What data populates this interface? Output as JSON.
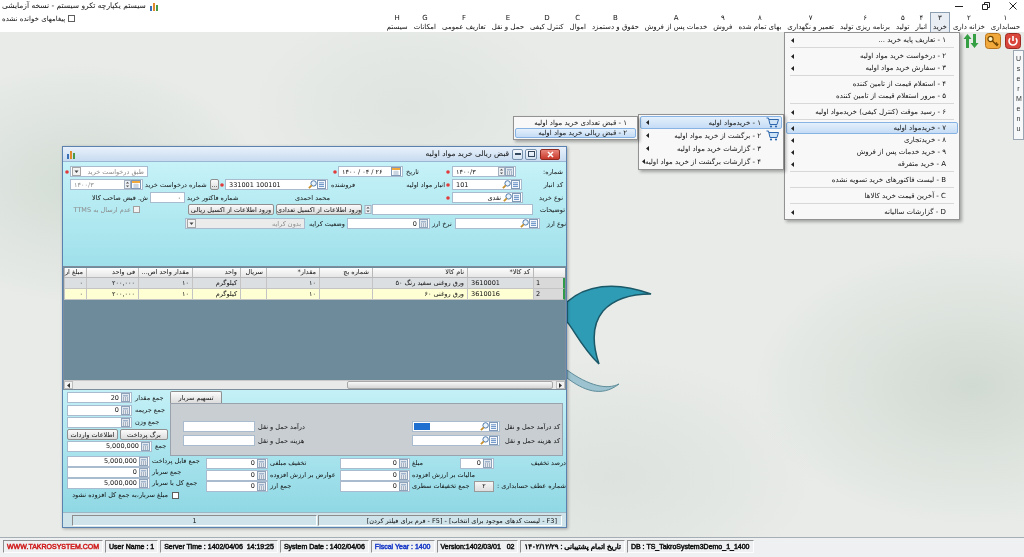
{
  "window": {
    "title": "سیستم یکپارچه تکرو سیستم - نسخه آزمایشی"
  },
  "unread_messages": {
    "label": "پیغامهای خوانده نشده",
    "checked": false
  },
  "menu_bar": [
    {
      "key": "۱",
      "label": "حسابداری",
      "selected": false
    },
    {
      "key": "۲",
      "label": "خزانه داری",
      "selected": false
    },
    {
      "key": "۳",
      "label": "خرید",
      "selected": true
    },
    {
      "key": "۴",
      "label": "انبار",
      "selected": false
    },
    {
      "key": "۵",
      "label": "تولید",
      "selected": false
    },
    {
      "key": "۶",
      "label": "برنامه ریزی تولید",
      "selected": false
    },
    {
      "key": "۷",
      "label": "تعمیر و نگهداری",
      "selected": false
    },
    {
      "key": "۸",
      "label": "بهای تمام شده",
      "selected": false
    },
    {
      "key": "۹",
      "label": "فروش",
      "selected": false
    },
    {
      "key": "A",
      "label": "خدمات پس از فروش",
      "selected": false
    },
    {
      "key": "B",
      "label": "حقوق و دستمزد",
      "selected": false
    },
    {
      "key": "C",
      "label": "اموال",
      "selected": false
    },
    {
      "key": "D",
      "label": "کنترل کیفی",
      "selected": false
    },
    {
      "key": "E",
      "label": "حمل و نقل",
      "selected": false
    },
    {
      "key": "F",
      "label": "تعاریف عمومی",
      "selected": false
    },
    {
      "key": "G",
      "label": "امکانات",
      "selected": false
    },
    {
      "key": "H",
      "label": "سیستم",
      "selected": false
    }
  ],
  "user_menu": {
    "label": "UserMenu"
  },
  "purchase_menu": {
    "groups": [
      [
        {
          "label": "۱ - تعاریف پایه خرید ...",
          "submenu": true,
          "selected": false
        }
      ],
      [
        {
          "label": "۲ - درخواست خرید مواد اولیه",
          "submenu": true,
          "selected": false
        },
        {
          "label": "۳ - سفارش خرید مواد اولیه",
          "submenu": true,
          "selected": false
        }
      ],
      [
        {
          "label": "۴ - استعلام قیمت از تامین کننده",
          "submenu": false,
          "selected": false
        },
        {
          "label": "۵ - مرور استعلام قیمت از تامین کننده",
          "submenu": false,
          "selected": false
        }
      ],
      [
        {
          "label": "۶ - رسید موقت (کنترل کیفی) خریدمواد اولیه",
          "submenu": true,
          "selected": false
        }
      ],
      [
        {
          "label": "۷ - خریدمواد اولیه",
          "submenu": true,
          "selected": true
        },
        {
          "label": "۸ - خریدتجاری",
          "submenu": true,
          "selected": false
        },
        {
          "label": "۹ - خرید خدمات پس از فروش",
          "submenu": true,
          "selected": false
        },
        {
          "label": "A - خرید متفرقه",
          "submenu": true,
          "selected": false
        }
      ],
      [
        {
          "label": "B - لیست فاکتورهای خرید تسویه نشده",
          "submenu": false,
          "selected": false
        }
      ],
      [
        {
          "label": "C - آخرین قیمت خرید کالاها",
          "submenu": false,
          "selected": false
        }
      ],
      [
        {
          "label": "D - گزارشات سالیانه",
          "submenu": true,
          "selected": false
        }
      ]
    ]
  },
  "materials_menu": {
    "items": [
      {
        "label": "۱ - خریدمواد اولیه",
        "kind": "icon",
        "submenu": true,
        "selected": true
      },
      {
        "label": "۲ - برگشت از خرید مواد اولیه",
        "kind": "icon",
        "submenu": true,
        "selected": false
      },
      {
        "label": "۳ - گزارشات خرید مواد اولیه",
        "kind": "plain",
        "submenu": true,
        "selected": false
      },
      {
        "label": "۴ - گزارشات برگشت از خرید مواد اولیه",
        "kind": "plain",
        "submenu": true,
        "selected": false
      }
    ]
  },
  "receipt_menu": {
    "items": [
      {
        "label": "۱ - قبض تعدادی خرید مواد اولیه",
        "selected": false
      },
      {
        "label": "۲ - قبض ریالی خرید مواد اولیه",
        "selected": true
      }
    ]
  },
  "dialog": {
    "title": "قبض ریالی خرید مواد اولیه",
    "form": {
      "number": {
        "label": "شماره:",
        "value": "۱۴۰۰/۳",
        "required": true
      },
      "date": {
        "label": "تاریخ",
        "value": "۱۴۰۰ / ۰۴ / ۲۶",
        "required": true
      },
      "basis": {
        "value": "طبق درخواست خرید",
        "required": true,
        "disabled": true
      },
      "warehouse": {
        "label": "کد انبار",
        "value": "101",
        "required": true,
        "name": "انبار مواد اولیه"
      },
      "vendor": {
        "label": "فروشنده",
        "value": "331001 100101",
        "required": true,
        "name": "محمد احمدی",
        "browse": "..."
      },
      "request_number": {
        "label": "شماره درخواست خرید",
        "value": "۱۴۰۰/۳",
        "disabled": true
      },
      "purchase_type": {
        "label": "نوع خرید",
        "value": "نقدی",
        "required": true
      },
      "invoice_number": {
        "label": "شماره فاکتور خرید",
        "value": "۰"
      },
      "owner_receipt": {
        "label": "ش. قبض صاحب کالا"
      },
      "description": {
        "label": "توضیحات"
      },
      "excel_buttons": [
        "ورود اطلاعات از اکسیل تعدادی",
        "ورود اطلاعات از اکسیل ریالی"
      ],
      "no_ttms": {
        "label": "عدم ارسال به TTMS",
        "checked": false,
        "disabled": true
      },
      "currency": {
        "label": "نوع ارز"
      },
      "exchange_rate": {
        "label": "نرخ ارز",
        "value": "0"
      },
      "freight_status": {
        "label": "وضعیت کرایه",
        "value": "بدون کرایه",
        "disabled": true
      }
    },
    "grid": {
      "columns": [
        "کد کالا*",
        "نام کالا",
        "شماره بچ",
        "مقدار*",
        "سریال",
        "واحد",
        "مقدار واحد اص...",
        "فی واحد",
        "مبلغ ار"
      ],
      "rows": [
        {
          "number": "1",
          "cells": [
            "3610001",
            "ورق روغنی سفید رنگ ۵۰",
            null,
            "۱۰",
            null,
            "کیلوگرم",
            "۱۰",
            "۲۰۰,۰۰۰",
            "۰"
          ],
          "selected": false
        },
        {
          "number": "2",
          "cells": [
            "3610016",
            "ورق روغنی ۶۰",
            null,
            "۱۰",
            null,
            "کیلوگرم",
            "۱۰",
            "۲۰۰,۰۰۰",
            "۰"
          ],
          "selected": true
        }
      ]
    },
    "totals": [
      {
        "label": "جمع مقدار",
        "value": "20"
      },
      {
        "label": "جمع جریمه",
        "value": "0"
      },
      {
        "label": "جمع وزن"
      }
    ],
    "buttons": [
      "برگ پرداخت",
      "اطلاعات واردات"
    ],
    "sum": {
      "label": "جمع",
      "value": "5,000,000"
    },
    "payable": [
      {
        "label": "جمع قابل پرداخت",
        "value": "5,000,000"
      },
      {
        "label": "جمع سربار",
        "value": "0"
      },
      {
        "label": "جمع کل با سربار",
        "value": "5,000,000"
      }
    ],
    "overhead_excluded": {
      "label": "مبلغ سربار،به جمع کل افزوده نشود",
      "checked": false
    },
    "overhead_tab": {
      "label": "تسهیم سربار"
    },
    "freight": [
      {
        "code_label": "کد درآمد حمل و نقل",
        "amount_label": "درآمد حمل و نقل",
        "focused": true
      },
      {
        "code_label": "کد هزینه حمل و نقل",
        "amount_label": "هزینه حمل و نقل",
        "focused": false
      }
    ],
    "adjustments": [
      [
        {
          "label": "درصد تخفیف",
          "value": "0",
          "kind": "amount"
        },
        {
          "label": "مبلغ",
          "value": "0",
          "kind": "amount"
        },
        {
          "label": "تخفیف مبلغی",
          "value": "0",
          "kind": "amount"
        }
      ],
      [
        {
          "label": "مالیات بر ارزش افزوده",
          "value": "0",
          "kind": "amount"
        },
        {
          "label": "عوارض بر ارزش افزوده",
          "value": "0",
          "kind": "amount"
        }
      ],
      [
        {
          "label": "شماره عطف حسابداری :",
          "value": "۲",
          "kind": "readonly"
        },
        {
          "label": "جمع تخفیفات سطری",
          "value": "0",
          "kind": "amount"
        },
        {
          "label": "جمع ارز",
          "value": "0",
          "kind": "amount"
        }
      ]
    ],
    "status": [
      "[F3 - لیست کدهای موجود برای انتخاب] - [F5 - فرم برای فیلتر کردن]",
      "1"
    ]
  },
  "status_bar": [
    {
      "text": "DB : TS_TakroSystem3Demo_1_1400",
      "color": "#111111"
    },
    {
      "text": "تاریخ اتمام پشتیبانی : ۱۴۰۲/۱۲/۲۹",
      "color": "#111111"
    },
    {
      "text": "Version:1402/03/01   02",
      "color": "#111111"
    },
    {
      "text": "Fiscal Year : 1400",
      "color": "#1f3fc8"
    },
    {
      "text": "System Date : 1402/04/06",
      "color": "#111111"
    },
    {
      "text": "Server Time : 1402/04/06  14:19:25",
      "color": "#111111"
    },
    {
      "text": "User Name : 1",
      "color": "#111111"
    },
    {
      "text": "WWW.TAKROSYSTEM.COM",
      "color": "#d01f1f"
    }
  ]
}
